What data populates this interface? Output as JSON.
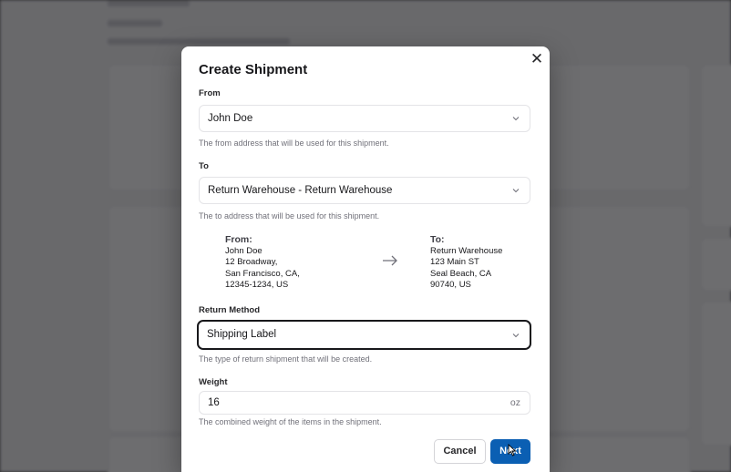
{
  "dialog": {
    "title": "Create Shipment",
    "close_glyph": "✕"
  },
  "from": {
    "label": "From",
    "value": "John Doe",
    "help": "The from address that will be used for this shipment."
  },
  "to": {
    "label": "To",
    "value": "Return Warehouse - Return Warehouse",
    "help": "The to address that will be used for this shipment."
  },
  "address_summary": {
    "from_heading": "From:",
    "from_lines": [
      "John Doe",
      "12 Broadway,",
      "San Francisco, CA,",
      "12345-1234, US"
    ],
    "to_heading": "To:",
    "to_lines": [
      "Return Warehouse",
      "123 Main ST",
      "Seal Beach, CA",
      "90740, US"
    ],
    "arrow_icon": "arrow-right-icon"
  },
  "return_method": {
    "label": "Return Method",
    "value": "Shipping Label",
    "help": "The type of return shipment that will be created."
  },
  "weight": {
    "label": "Weight",
    "value": "16",
    "unit": "oz",
    "help": "The combined weight of the items in the shipment."
  },
  "actions": {
    "cancel_label": "Cancel",
    "next_label": "Next"
  },
  "colors": {
    "primary": "#0b5fb3",
    "overlay": "#141416"
  }
}
